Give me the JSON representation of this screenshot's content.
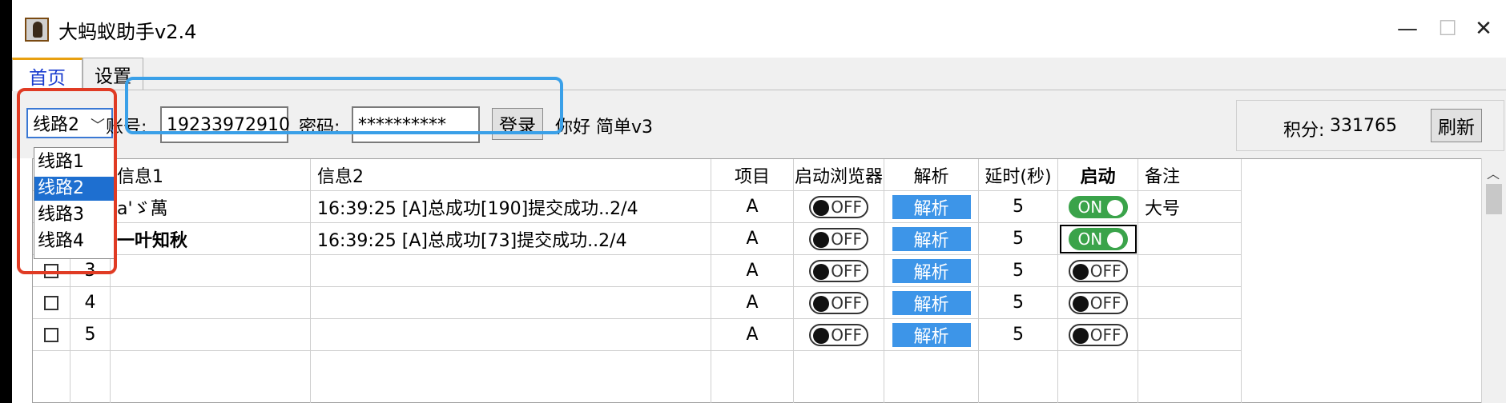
{
  "window": {
    "title": "大蚂蚁助手v2.4",
    "minimize": "—",
    "maximize": "☐",
    "close": "✕"
  },
  "tabs": [
    {
      "label": "首页",
      "active": true
    },
    {
      "label": "设置",
      "active": false
    }
  ],
  "toolbar": {
    "route_selected": "线路2",
    "route_options": [
      "线路1",
      "线路2",
      "线路3",
      "线路4"
    ],
    "account_label": "账号:",
    "account_value": "19233972910",
    "password_label": "密码:",
    "password_value": "**********",
    "login_button": "登录",
    "greeting": "你好 简单v3",
    "points_label": "积分:",
    "points_value": "331765",
    "refresh_button": "刷新"
  },
  "table": {
    "columns": [
      "信息1",
      "信息2",
      "项目",
      "启动浏览器",
      "解析",
      "延时(秒)",
      "启动",
      "备注"
    ],
    "rows": [
      {
        "num": "",
        "info1": "a'ゞ萬",
        "info2": "16:39:25 [A]总成功[190]提交成功..2/4",
        "project": "A",
        "browser": "OFF",
        "parse": "解析",
        "delay": "5",
        "start": "ON",
        "note": "大号"
      },
      {
        "num": "",
        "info1": "一叶知秋",
        "info2": "16:39:25 [A]总成功[73]提交成功..2/4",
        "project": "A",
        "browser": "OFF",
        "parse": "解析",
        "delay": "5",
        "start": "ON",
        "note": ""
      },
      {
        "num": "3",
        "info1": "",
        "info2": "",
        "project": "A",
        "browser": "OFF",
        "parse": "解析",
        "delay": "5",
        "start": "OFF",
        "note": ""
      },
      {
        "num": "4",
        "info1": "",
        "info2": "",
        "project": "A",
        "browser": "OFF",
        "parse": "解析",
        "delay": "5",
        "start": "OFF",
        "note": ""
      },
      {
        "num": "5",
        "info1": "",
        "info2": "",
        "project": "A",
        "browser": "OFF",
        "parse": "解析",
        "delay": "5",
        "start": "OFF",
        "note": ""
      }
    ]
  },
  "colors": {
    "accent": "#1e6fd0",
    "parse_button": "#3d95e8",
    "on_toggle": "#3aa34a",
    "highlight_red": "#e03b24",
    "highlight_blue": "#3aa0e8"
  }
}
